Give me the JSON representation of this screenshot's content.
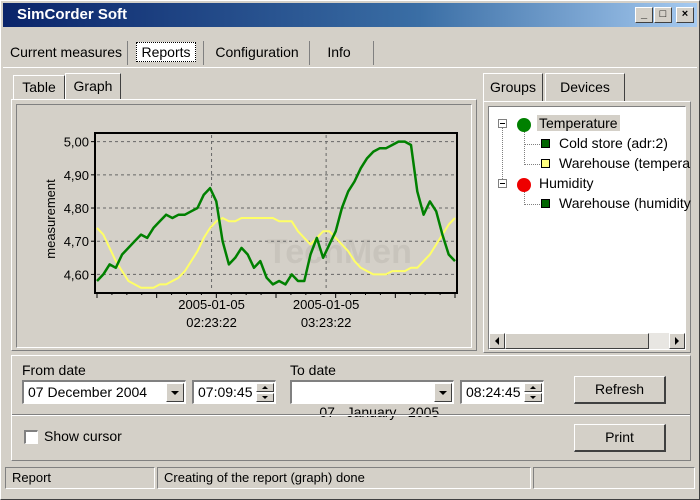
{
  "window": {
    "title": "SimCorder Soft",
    "minimize": "_",
    "maximize": "□",
    "close": "×"
  },
  "main_tabs": [
    "Current measures",
    "Reports",
    "Configuration",
    "Info"
  ],
  "sub_tabs": [
    "Table",
    "Graph"
  ],
  "side_tabs": [
    "Groups",
    "Devices"
  ],
  "tree": {
    "group1": {
      "label": "Temperature",
      "color": "#008000"
    },
    "group1_items": [
      {
        "label": "Cold store (adr:2)",
        "color": "#006400"
      },
      {
        "label": "Warehouse (tempera",
        "color": "#ffff80"
      }
    ],
    "group2": {
      "label": "Humidity",
      "color": "#ee0000"
    },
    "group2_items": [
      {
        "label": "Warehouse (humidity",
        "color": "#006400"
      }
    ]
  },
  "watermark": "TechMen",
  "chart_data": {
    "type": "line",
    "ylabel": "measurement",
    "ylim": [
      4.55,
      5.02
    ],
    "yticks": [
      "5,00",
      "4,90",
      "4,80",
      "4,70",
      "4,60"
    ],
    "ytick_values": [
      5.0,
      4.9,
      4.8,
      4.7,
      4.6
    ],
    "xticks": [
      {
        "date": "2005-01-05",
        "time": "02:23:22",
        "pos": 0.32
      },
      {
        "date": "2005-01-05",
        "time": "03:23:22",
        "pos": 0.64
      }
    ],
    "series": [
      {
        "color": "#008000",
        "values": [
          4.58,
          4.6,
          4.63,
          4.62,
          4.66,
          4.68,
          4.7,
          4.72,
          4.71,
          4.74,
          4.76,
          4.78,
          4.77,
          4.78,
          4.78,
          4.79,
          4.8,
          4.84,
          4.86,
          4.82,
          4.7,
          4.63,
          4.65,
          4.68,
          4.66,
          4.62,
          4.64,
          4.59,
          4.57,
          4.58,
          4.57,
          4.6,
          4.58,
          4.58,
          4.66,
          4.71,
          4.65,
          4.69,
          4.73,
          4.8,
          4.85,
          4.88,
          4.92,
          4.95,
          4.97,
          4.98,
          4.98,
          4.99,
          5.0,
          5.0,
          4.99,
          4.85,
          4.78,
          4.82,
          4.79,
          4.72,
          4.66,
          4.64
        ]
      },
      {
        "color": "#ffff66",
        "values": [
          4.74,
          4.72,
          4.68,
          4.64,
          4.61,
          4.58,
          4.57,
          4.56,
          4.56,
          4.56,
          4.57,
          4.57,
          4.58,
          4.59,
          4.61,
          4.64,
          4.67,
          4.71,
          4.74,
          4.76,
          4.77,
          4.76,
          4.76,
          4.77,
          4.77,
          4.77,
          4.77,
          4.77,
          4.77,
          4.76,
          4.76,
          4.76,
          4.73,
          4.71,
          4.69,
          4.71,
          4.73,
          4.73,
          4.71,
          4.69,
          4.67,
          4.64,
          4.62,
          4.61,
          4.6,
          4.6,
          4.6,
          4.61,
          4.61,
          4.61,
          4.62,
          4.62,
          4.64,
          4.66,
          4.69,
          4.72,
          4.75,
          4.77
        ]
      }
    ]
  },
  "dates": {
    "from_label": "From date",
    "from_date": "07 December 2004",
    "from_time": "07:09:45",
    "to_label": "To date",
    "to_date": "07   January   2005",
    "to_time": "08:24:45"
  },
  "buttons": {
    "refresh": "Refresh",
    "print": "Print"
  },
  "show_cursor": {
    "label": "Show cursor",
    "checked": false
  },
  "status": {
    "left": "Report",
    "message": "Creating of the report (graph) done"
  }
}
